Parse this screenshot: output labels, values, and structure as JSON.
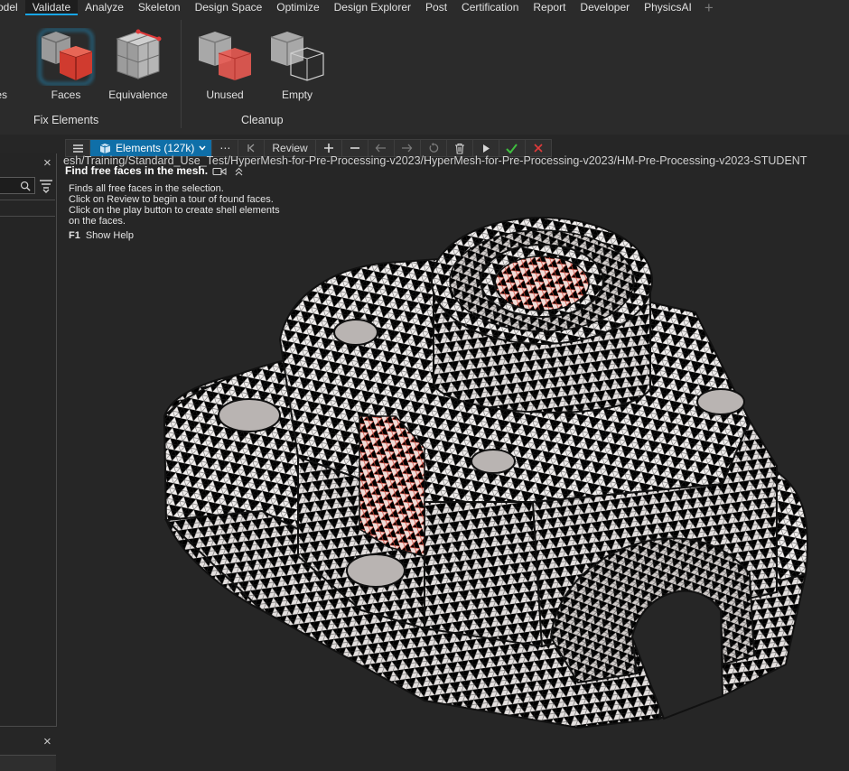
{
  "menu": {
    "items": [
      "odel",
      "Validate",
      "Analyze",
      "Skeleton",
      "Design Space",
      "Optimize",
      "Design Explorer",
      "Post",
      "Certification",
      "Report",
      "Developer",
      "PhysicsAI"
    ],
    "active": "Validate",
    "add_icon": "plus-icon"
  },
  "ribbon": {
    "fix_elements": {
      "group_label": "Fix Elements",
      "tools": [
        "es",
        "Faces",
        "Equivalence"
      ]
    },
    "cleanup": {
      "group_label": "Cleanup",
      "tools": [
        "Unused",
        "Empty"
      ]
    }
  },
  "minibar": {
    "menu_icon": "hamburger-icon",
    "selector_label": "Elements (127k)",
    "more_label": "⋯",
    "review_label": "Review",
    "first_icon": "skip-first-icon",
    "add_icon": "plus-icon",
    "remove_icon": "minus-icon",
    "prev_icon": "arrow-left-icon",
    "next_icon": "arrow-right-icon",
    "reset_icon": "rotate-icon",
    "delete_icon": "trash-icon",
    "play_icon": "play-icon",
    "accept_icon": "check-icon",
    "cancel_icon": "close-icon"
  },
  "path_text": "esh/Training/Standard_Use_Test/HyperMesh-for-Pre-Processing-v2023/HyperMesh-for-Pre-Processing-v2023/HM-Pre-Processing-v2023-STUDENT",
  "tooltip": {
    "title": "Find free faces in the mesh.",
    "description": "Finds all free faces in the selection.\nClick on Review to begin a tour of found faces.\nClick on the play button to create shell elements\non the faces.",
    "help_key": "F1",
    "help_label": "Show Help"
  },
  "colors": {
    "accent": "#18a6e6",
    "selector_bg": "#0f6fa8",
    "accept": "#3fbf3f",
    "cancel": "#e03a3a",
    "mesh_face": "#f2efee",
    "free_face": "#e8b4ae"
  }
}
